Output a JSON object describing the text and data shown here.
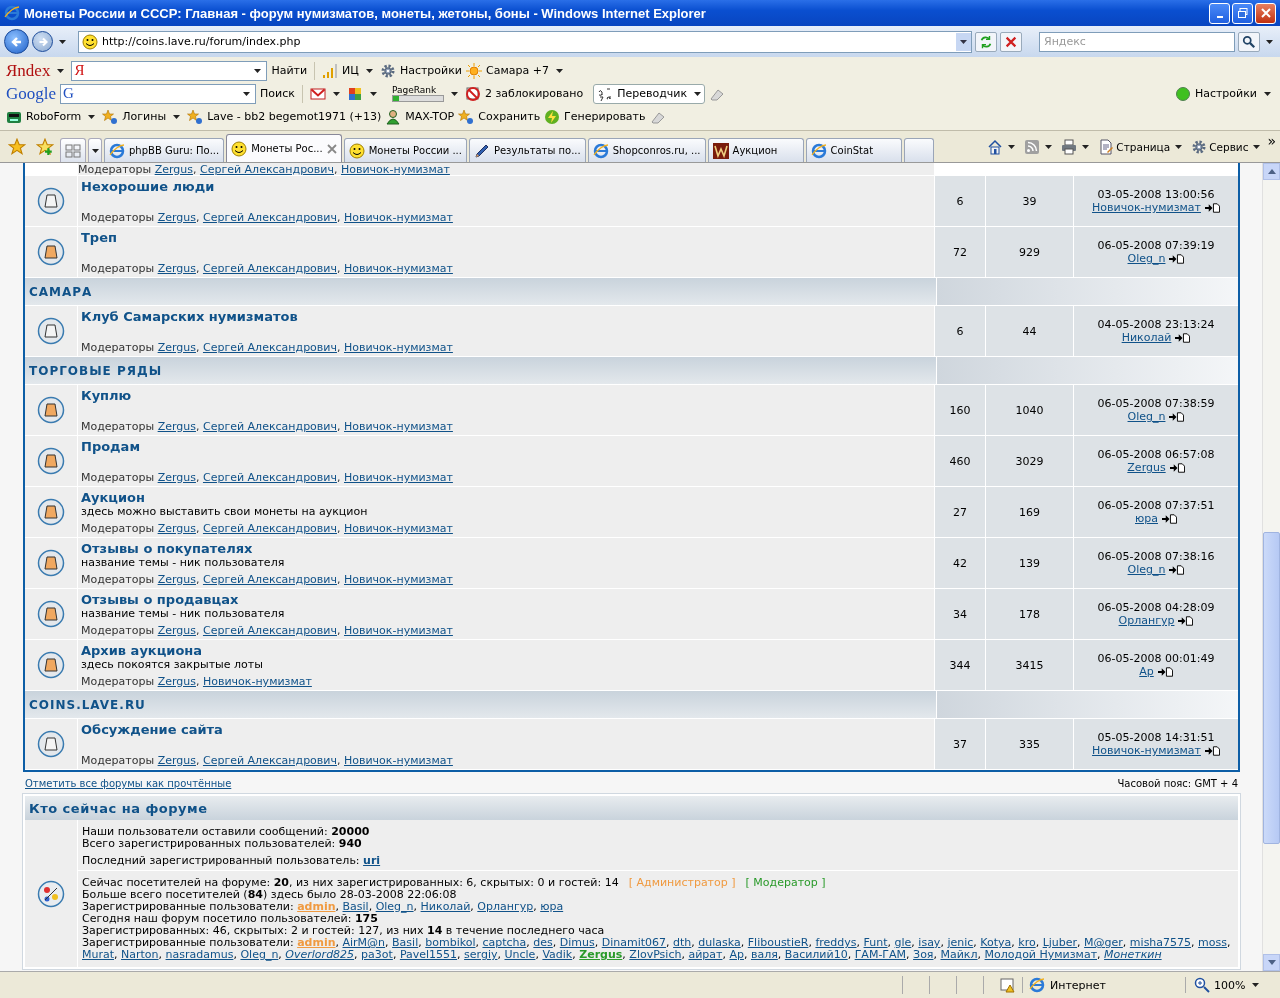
{
  "list_separator": ", ",
  "window": {
    "title": "Монеты России и СССР: Главная - форум нумизматов, монеты, жетоны, боны - Windows Internet Explorer"
  },
  "address_bar": {
    "url": "http://coins.lave.ru/forum/index.php",
    "search_placeholder": "Яндекс"
  },
  "toolbars": [
    {
      "items": [
        {
          "kind": "logo",
          "label": "Яndex",
          "dropdown": true
        },
        {
          "kind": "field",
          "label": "Я",
          "dropdown": true
        },
        {
          "kind": "button",
          "label": "Найти"
        },
        {
          "kind": "bars",
          "label": "ИЦ",
          "dropdown": true
        },
        {
          "kind": "gear",
          "label": "Настройки"
        },
        {
          "kind": "sun",
          "label": "Самара +7",
          "dropdown": true
        }
      ]
    },
    {
      "items": [
        {
          "kind": "logo",
          "label": "Google"
        },
        {
          "kind": "field",
          "label": "G",
          "dropdown": true
        },
        {
          "kind": "button",
          "label": "Поиск"
        },
        {
          "kind": "mail",
          "dropdown": true
        },
        {
          "kind": "puzzle",
          "dropdown": true
        },
        {
          "kind": "pagerank",
          "label": "PageRank",
          "level": 0.12,
          "dropdown": true
        },
        {
          "kind": "blocked",
          "label": "2 заблокировано"
        },
        {
          "kind": "translate",
          "label": "Переводчик",
          "dropdown": true
        },
        {
          "kind": "eraser"
        }
      ],
      "right": {
        "label": "Настройки",
        "dropdown": true
      }
    },
    {
      "items": [
        {
          "kind": "robo",
          "label": "RoboForm",
          "dropdown": true
        },
        {
          "kind": "stars",
          "label": "Логины",
          "dropdown": true
        },
        {
          "kind": "stars",
          "label": "Lave - bb2 begemot1971 (+13)"
        },
        {
          "kind": "person",
          "label": "MAX-TOP"
        },
        {
          "kind": "stars",
          "label": "Сохранить"
        },
        {
          "kind": "bolt",
          "label": "Генерировать"
        },
        {
          "kind": "eraser"
        }
      ]
    }
  ],
  "tabs": [
    {
      "kind": "ie",
      "label": "phpBB Guru: По...",
      "selected": false
    },
    {
      "kind": "smiley",
      "label": "Монеты Рос...",
      "selected": true
    },
    {
      "kind": "smiley",
      "label": "Монеты России ...",
      "selected": false
    },
    {
      "kind": "pen",
      "label": "Результаты по...",
      "selected": false
    },
    {
      "kind": "ie",
      "label": "Shopconros.ru, ...",
      "selected": false
    },
    {
      "kind": "w",
      "label": "Аукцион",
      "selected": false
    },
    {
      "kind": "ie",
      "label": "CoinStat",
      "selected": false
    }
  ],
  "command_bar": [
    {
      "kind": "home",
      "dropdown": true
    },
    {
      "kind": "rss",
      "dropdown": true
    },
    {
      "kind": "print",
      "dropdown": true
    },
    {
      "kind": "page",
      "label": "Страница",
      "dropdown": true
    },
    {
      "kind": "gear",
      "label": "Сервис",
      "dropdown": true
    }
  ],
  "command_overflow": "»",
  "sections": [
    {
      "forums": [
        {
          "moderators_label": "Модераторы",
          "moderators": [
            "Zergus",
            "Сергей Александрович",
            "Новичок-нумизмат"
          ]
        }
      ]
    },
    {
      "forums": [
        {
          "name": "Нехорошие люди",
          "unread": false,
          "moderators_label": "Модераторы",
          "moderators": [
            "Zergus",
            "Сергей Александрович",
            "Новичок-нумизмат"
          ],
          "topics": "6",
          "posts": "39",
          "last_post": {
            "time": "03-05-2008 13:00:56",
            "user": "Новичок-нумизмат"
          }
        },
        {
          "name": "Треп",
          "unread": true,
          "moderators_label": "Модераторы",
          "moderators": [
            "Zergus",
            "Сергей Александрович",
            "Новичок-нумизмат"
          ],
          "topics": "72",
          "posts": "929",
          "last_post": {
            "time": "06-05-2008 07:39:19",
            "user": "Oleg_n"
          }
        }
      ]
    },
    {
      "title": "САМАРА",
      "forums": [
        {
          "name": "Клуб Самарских нумизматов",
          "unread": false,
          "moderators_label": "Модераторы",
          "moderators": [
            "Zergus",
            "Сергей Александрович",
            "Новичок-нумизмат"
          ],
          "topics": "6",
          "posts": "44",
          "last_post": {
            "time": "04-05-2008 23:13:24",
            "user": "Николай"
          }
        }
      ]
    },
    {
      "title": "ТОРГОВЫЕ РЯДЫ",
      "forums": [
        {
          "name": "Куплю",
          "unread": true,
          "moderators_label": "Модераторы",
          "moderators": [
            "Zergus",
            "Сергей Александрович",
            "Новичок-нумизмат"
          ],
          "topics": "160",
          "posts": "1040",
          "last_post": {
            "time": "06-05-2008 07:38:59",
            "user": "Oleg_n"
          }
        },
        {
          "name": "Продам",
          "unread": true,
          "moderators_label": "Модераторы",
          "moderators": [
            "Zergus",
            "Сергей Александрович",
            "Новичок-нумизмат"
          ],
          "topics": "460",
          "posts": "3029",
          "last_post": {
            "time": "06-05-2008 06:57:08",
            "user": "Zergus"
          }
        },
        {
          "name": "Аукцион",
          "description": "здесь можно выставить свои монеты на аукцион",
          "unread": true,
          "moderators_label": "Модераторы",
          "moderators": [
            "Zergus",
            "Сергей Александрович",
            "Новичок-нумизмат"
          ],
          "topics": "27",
          "posts": "169",
          "last_post": {
            "time": "06-05-2008 07:37:51",
            "user": "юра"
          }
        },
        {
          "name": "Отзывы о покупателях",
          "description": "название темы - ник пользователя",
          "unread": true,
          "moderators_label": "Модераторы",
          "moderators": [
            "Zergus",
            "Сергей Александрович",
            "Новичок-нумизмат"
          ],
          "topics": "42",
          "posts": "139",
          "last_post": {
            "time": "06-05-2008 07:38:16",
            "user": "Oleg_n"
          }
        },
        {
          "name": "Отзывы о продавцах",
          "description": "название темы - ник пользователя",
          "unread": true,
          "moderators_label": "Модераторы",
          "moderators": [
            "Zergus",
            "Сергей Александрович",
            "Новичок-нумизмат"
          ],
          "topics": "34",
          "posts": "178",
          "last_post": {
            "time": "06-05-2008 04:28:09",
            "user": "Орлангур"
          }
        },
        {
          "name": "Архив аукциона",
          "description": "здесь покоятся закрытые лоты",
          "unread": true,
          "moderators_label": "Модераторы",
          "moderators": [
            "Zergus",
            "Новичок-нумизмат"
          ],
          "topics": "344",
          "posts": "3415",
          "last_post": {
            "time": "06-05-2008 00:01:49",
            "user": "Ap"
          }
        }
      ]
    },
    {
      "title": "COINS.LAVE.RU",
      "forums": [
        {
          "name": "Обсуждение сайта",
          "unread": false,
          "moderators_label": "Модераторы",
          "moderators": [
            "Zergus",
            "Сергей Александрович",
            "Новичок-нумизмат"
          ],
          "topics": "37",
          "posts": "335",
          "last_post": {
            "time": "05-05-2008 14:31:51",
            "user": "Новичок-нумизмат"
          }
        }
      ]
    }
  ],
  "mark_read_link": "Отметить все форумы как прочтённые",
  "timezone": "Часовой пояс: GMT + 4",
  "online": {
    "title": "Кто сейчас на форуме",
    "stats": [
      "Наши пользователи оставили сообщений: **20000**",
      "Всего зарегистрированных пользователей: **940**"
    ],
    "newest": {
      "label": "Последний зарегистрированный пользователь:",
      "user": "uri"
    },
    "now": "Сейчас посетителей на форуме: **20**, из них зарегистрированных: 6, скрытых: 0 и гостей: 14",
    "legend": [
      {
        "kind": "admin",
        "label": "[ Администратор ]"
      },
      {
        "kind": "moderator",
        "label": "[ Модератор ]"
      }
    ],
    "record": "Больше всего посетителей (**84**) здесь было 28-03-2008 22:06:08",
    "online_users": {
      "label": "Зарегистрированные пользователи:",
      "users": [
        {
          "name": "admin",
          "kind": "admin"
        },
        {
          "name": "Basil",
          "kind": "user"
        },
        {
          "name": "Oleg_n",
          "kind": "user"
        },
        {
          "name": "Николай",
          "kind": "user"
        },
        {
          "name": "Орлангур",
          "kind": "user"
        },
        {
          "name": "юра",
          "kind": "user"
        }
      ]
    },
    "today": "Сегодня наш форум посетило пользователей: **175**",
    "today_counts": "Зарегистрированных: 46, скрытых: 2 и гостей: 127, из них **14** в течение последнего часа",
    "today_users": {
      "label": "Зарегистрированные пользователи:",
      "users": [
        {
          "name": "admin",
          "kind": "admin"
        },
        {
          "name": "AirM@n",
          "kind": "user"
        },
        {
          "name": "Basil",
          "kind": "user"
        },
        {
          "name": "bombikol",
          "kind": "user"
        },
        {
          "name": "captcha",
          "kind": "user"
        },
        {
          "name": "des",
          "kind": "user"
        },
        {
          "name": "Dimus",
          "kind": "user"
        },
        {
          "name": "Dinamit067",
          "kind": "user"
        },
        {
          "name": "dth",
          "kind": "user"
        },
        {
          "name": "dulaska",
          "kind": "user"
        },
        {
          "name": "FliboustieR",
          "kind": "user"
        },
        {
          "name": "freddys",
          "kind": "user"
        },
        {
          "name": "Funt",
          "kind": "user"
        },
        {
          "name": "gle",
          "kind": "user"
        },
        {
          "name": "isay",
          "kind": "user"
        },
        {
          "name": "jenic",
          "kind": "user"
        },
        {
          "name": "Kotya",
          "kind": "user"
        },
        {
          "name": "kro",
          "kind": "user"
        },
        {
          "name": "Ljuber",
          "kind": "user"
        },
        {
          "name": "M@ger",
          "kind": "user"
        },
        {
          "name": "misha7575",
          "kind": "user"
        },
        {
          "name": "moss",
          "kind": "user"
        },
        {
          "name": "Murat",
          "kind": "user"
        },
        {
          "name": "Narton",
          "kind": "user"
        },
        {
          "name": "nasradamus",
          "kind": "user"
        },
        {
          "name": "Oleg_n",
          "kind": "user"
        },
        {
          "name": "Overlord825",
          "kind": "hidden"
        },
        {
          "name": "pa3ot",
          "kind": "user"
        },
        {
          "name": "Pavel1551",
          "kind": "user"
        },
        {
          "name": "sergiy",
          "kind": "user"
        },
        {
          "name": "Uncle",
          "kind": "user"
        },
        {
          "name": "Vadik",
          "kind": "user"
        },
        {
          "name": "Zergus",
          "kind": "moderator"
        },
        {
          "name": "ZlovPsich",
          "kind": "user"
        },
        {
          "name": "айрат",
          "kind": "user"
        },
        {
          "name": "Ap",
          "kind": "user"
        },
        {
          "name": "валя",
          "kind": "user"
        },
        {
          "name": "Василий10",
          "kind": "user"
        },
        {
          "name": "ГАМ-ГАМ",
          "kind": "user"
        },
        {
          "name": "Зоя",
          "kind": "user"
        },
        {
          "name": "Майкл",
          "kind": "user"
        },
        {
          "name": "Молодой Нумизмат",
          "kind": "user"
        },
        {
          "name": "Монеткин",
          "kind": "hidden"
        }
      ]
    }
  },
  "status_bar": {
    "zone": "Интернет",
    "zoom": "100%"
  }
}
